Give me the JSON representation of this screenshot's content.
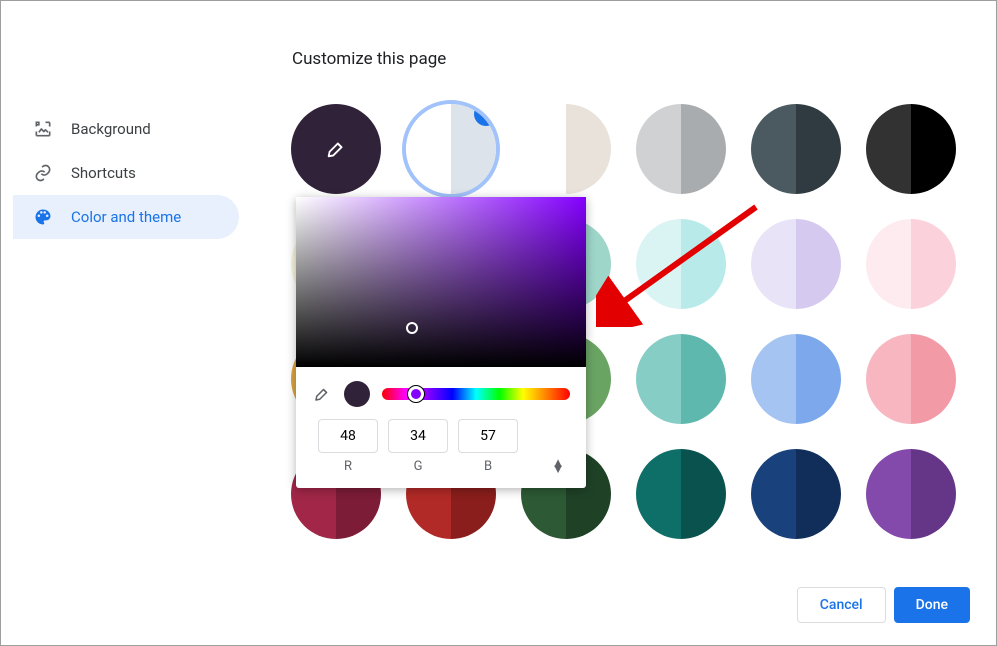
{
  "title": "Customize this page",
  "sidebar": {
    "items": [
      {
        "label": "Background"
      },
      {
        "label": "Shortcuts"
      },
      {
        "label": "Color and theme"
      }
    ],
    "active_index": 2
  },
  "grid": {
    "swatches": [
      {
        "type": "eyedropper",
        "left": "#302239",
        "right": "#302239"
      },
      {
        "type": "selected",
        "left": "#ffffff",
        "right": "#dce3ea"
      },
      {
        "type": "color",
        "left": "#ffffff",
        "right": "#e8e2da"
      },
      {
        "type": "color",
        "left": "#cfd1d3",
        "right": "#a9acae"
      },
      {
        "type": "color",
        "left": "#4a5a60",
        "right": "#2f3b40"
      },
      {
        "type": "color",
        "left": "#323232",
        "right": "#000000"
      },
      {
        "type": "color",
        "left": "#f7f4dd",
        "right": "#eee8b8"
      },
      {
        "type": "color",
        "left": "#f8e6d0",
        "right": "#f2d0a6"
      },
      {
        "type": "color",
        "left": "#b9e4da",
        "right": "#9ed6ca"
      },
      {
        "type": "color",
        "left": "#daf3f3",
        "right": "#b8eaea"
      },
      {
        "type": "color",
        "left": "#e9e3f7",
        "right": "#d5c9f0"
      },
      {
        "type": "color",
        "left": "#fdebef",
        "right": "#fbd2db"
      },
      {
        "type": "color",
        "left": "#d9a441",
        "right": "#c78e2b"
      },
      {
        "type": "color",
        "left": "#f0784a",
        "right": "#e4562c"
      },
      {
        "type": "color",
        "left": "#8bbd85",
        "right": "#6aa463"
      },
      {
        "type": "color",
        "left": "#86cdc6",
        "right": "#5fb8ae"
      },
      {
        "type": "color",
        "left": "#a6c4f2",
        "right": "#7da8eb"
      },
      {
        "type": "color",
        "left": "#f7b6c0",
        "right": "#f39aa7"
      },
      {
        "type": "color",
        "left": "#a12648",
        "right": "#7d1c37"
      },
      {
        "type": "color",
        "left": "#b22a27",
        "right": "#8a1e1c"
      },
      {
        "type": "color",
        "left": "#2d5a34",
        "right": "#1f4227"
      },
      {
        "type": "color",
        "left": "#0e6e68",
        "right": "#0a524d"
      },
      {
        "type": "color",
        "left": "#19427d",
        "right": "#112e5a"
      },
      {
        "type": "color",
        "left": "#8349ab",
        "right": "#653688"
      }
    ]
  },
  "picker": {
    "r": "48",
    "g": "34",
    "b": "57",
    "rLabel": "R",
    "gLabel": "G",
    "bLabel": "B"
  },
  "footer": {
    "cancel": "Cancel",
    "done": "Done"
  }
}
